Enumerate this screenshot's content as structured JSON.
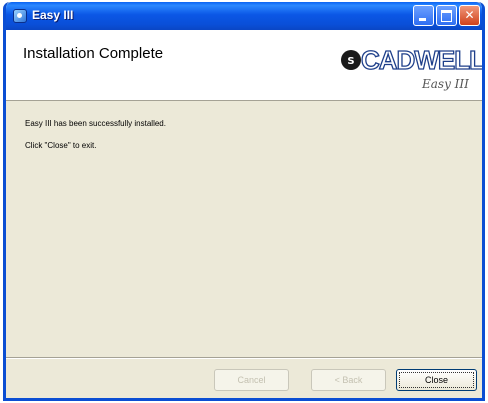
{
  "window": {
    "title": "Easy III",
    "controls": {
      "minimize": "minimize",
      "maximize": "maximize",
      "close": "✕"
    }
  },
  "banner": {
    "title": "Installation Complete",
    "logo_text": "CADWELL",
    "logo_script": "Easy III"
  },
  "content": {
    "line1": "Easy III has been successfully installed.",
    "line2": "Click \"Close\" to exit."
  },
  "buttons": {
    "cancel": "Cancel",
    "back": "< Back",
    "close": "Close"
  },
  "colors": {
    "titlebar": "#0a4fd8",
    "dialog_background": "#ece9d8",
    "banner_background": "#ffffff",
    "close_button": "#d0421c"
  },
  "icons": {
    "app": "app-icon",
    "logo": "cadwell-logo"
  }
}
